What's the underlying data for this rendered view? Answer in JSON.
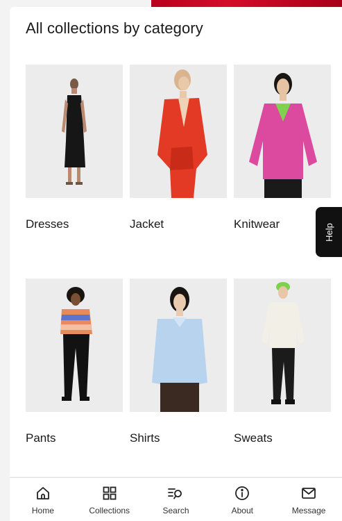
{
  "header": {
    "title": "All collections by category"
  },
  "categories": [
    {
      "label": "Dresses"
    },
    {
      "label": "Jacket"
    },
    {
      "label": "Knitwear"
    },
    {
      "label": "Pants"
    },
    {
      "label": "Shirts"
    },
    {
      "label": "Sweats"
    }
  ],
  "help": {
    "label": "Help"
  },
  "nav": {
    "items": [
      {
        "label": "Home",
        "icon": "home-icon"
      },
      {
        "label": "Collections",
        "icon": "grid-icon"
      },
      {
        "label": "Search",
        "icon": "search-icon"
      },
      {
        "label": "About",
        "icon": "info-icon"
      },
      {
        "label": "Message",
        "icon": "mail-icon"
      }
    ]
  },
  "colors": {
    "accent_banner": "#c8102e",
    "nav_text": "#333333",
    "help_tab": "#111111"
  }
}
